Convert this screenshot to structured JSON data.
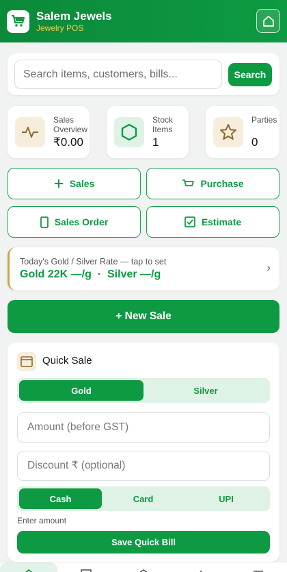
{
  "app": {
    "title": "Salem Jewels",
    "subtitle": "Jewelry POS"
  },
  "search": {
    "placeholder": "Search items, customers, bills...",
    "button": "Search"
  },
  "stats": [
    {
      "label": "Sales Overview",
      "value": "₹0.00",
      "icon": "pulse-icon"
    },
    {
      "label": "Stock Items",
      "value": "1",
      "icon": "hexagon-icon"
    },
    {
      "label": "Parties",
      "value": "0",
      "icon": "star-icon"
    }
  ],
  "actions": {
    "sales": "Sales",
    "purchase": "Purchase",
    "sales_order": "Sales Order",
    "estimate": "Estimate"
  },
  "rate": {
    "hint": "Today's Gold / Silver Rate — tap to set",
    "values": "Gold 22K —/g  ·  Silver —/g"
  },
  "new_sale": "+ New Sale",
  "quick_sale": {
    "title": "Quick Sale",
    "metal_tabs": [
      "Gold",
      "Silver"
    ],
    "metal_selected": "Gold",
    "amount_placeholder": "Amount (before GST)",
    "discount_placeholder": "Discount ₹ (optional)",
    "payment_tabs": [
      "Cash",
      "Card",
      "UPI"
    ],
    "payment_selected": "Cash",
    "hint": "Enter amount",
    "save": "Save Quick Bill"
  },
  "bottom_nav": [
    "home-icon",
    "box-icon",
    "tag-icon",
    "user-icon",
    "menu-icon"
  ],
  "colors": {
    "primary": "#0d9a43",
    "accent_gold": "#f2c94c",
    "background": "#f1f3f2"
  }
}
